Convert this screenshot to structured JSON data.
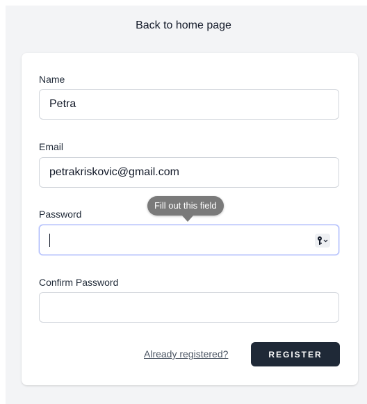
{
  "header": {
    "back_link": "Back to home page"
  },
  "form": {
    "name": {
      "label": "Name",
      "value": "Petra"
    },
    "email": {
      "label": "Email",
      "value": "petrakriskovic@gmail.com"
    },
    "password": {
      "label": "Password",
      "value": "",
      "icon": "key-icon"
    },
    "confirm_password": {
      "label": "Confirm Password",
      "value": ""
    },
    "validation_tooltip": "Fill out this field",
    "already_registered_link": "Already registered?",
    "register_button": "Register"
  },
  "colors": {
    "page_background": "#f3f4f6",
    "card_background": "#ffffff",
    "button_background": "#1f2937",
    "focus_border": "#a5b4fc",
    "tooltip_background": "#7a7a7a"
  }
}
